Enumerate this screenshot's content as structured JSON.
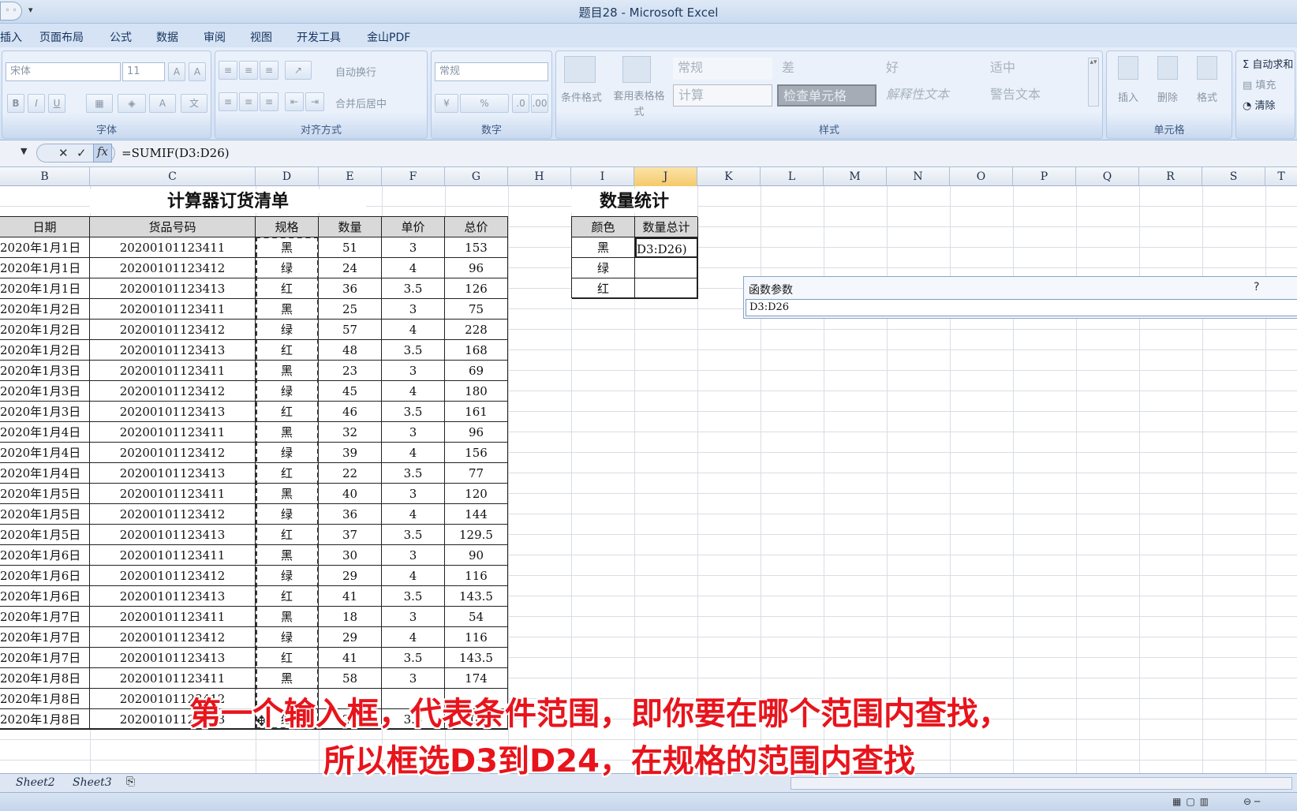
{
  "window": {
    "title": "题目28 - Microsoft Excel"
  },
  "menu": [
    "插入",
    "页面布局",
    "公式",
    "数据",
    "审阅",
    "视图",
    "开发工具",
    "金山PDF"
  ],
  "ribbon": {
    "font_group": {
      "label": "字体",
      "font_name": "宋体",
      "font_size": "11"
    },
    "align_group": {
      "label": "对齐方式",
      "wrap": "自动换行",
      "merge": "合并后居中"
    },
    "number_group": {
      "label": "数字",
      "format": "常规"
    },
    "styles_group": {
      "label": "样式",
      "cond_format": "条件格式",
      "table_format": "套用表格格式",
      "styles": [
        "常规",
        "差",
        "好",
        "适中",
        "计算",
        "检查单元格",
        "解释性文本",
        "警告文本"
      ]
    },
    "cells_group": {
      "label": "单元格",
      "insert": "插入",
      "delete": "删除",
      "format": "格式"
    },
    "edit_group": {
      "autosum": "自动求和",
      "fill": "填充",
      "clear": "清除"
    }
  },
  "formula_bar": {
    "formula": "=SUMIF(D3:D26)"
  },
  "columns": [
    "B",
    "C",
    "D",
    "E",
    "F",
    "G",
    "H",
    "I",
    "J",
    "K",
    "L",
    "M",
    "N",
    "O",
    "P",
    "Q",
    "R",
    "S",
    "T"
  ],
  "table1": {
    "title": "计算器订货清单",
    "headers": [
      "日期",
      "货品号码",
      "规格",
      "数量",
      "单价",
      "总价"
    ],
    "rows": [
      [
        "2020年1月1日",
        "20200101123411",
        "黑",
        "51",
        "3",
        "153"
      ],
      [
        "2020年1月1日",
        "20200101123412",
        "绿",
        "24",
        "4",
        "96"
      ],
      [
        "2020年1月1日",
        "20200101123413",
        "红",
        "36",
        "3.5",
        "126"
      ],
      [
        "2020年1月2日",
        "20200101123411",
        "黑",
        "25",
        "3",
        "75"
      ],
      [
        "2020年1月2日",
        "20200101123412",
        "绿",
        "57",
        "4",
        "228"
      ],
      [
        "2020年1月2日",
        "20200101123413",
        "红",
        "48",
        "3.5",
        "168"
      ],
      [
        "2020年1月3日",
        "20200101123411",
        "黑",
        "23",
        "3",
        "69"
      ],
      [
        "2020年1月3日",
        "20200101123412",
        "绿",
        "45",
        "4",
        "180"
      ],
      [
        "2020年1月3日",
        "20200101123413",
        "红",
        "46",
        "3.5",
        "161"
      ],
      [
        "2020年1月4日",
        "20200101123411",
        "黑",
        "32",
        "3",
        "96"
      ],
      [
        "2020年1月4日",
        "20200101123412",
        "绿",
        "39",
        "4",
        "156"
      ],
      [
        "2020年1月4日",
        "20200101123413",
        "红",
        "22",
        "3.5",
        "77"
      ],
      [
        "2020年1月5日",
        "20200101123411",
        "黑",
        "40",
        "3",
        "120"
      ],
      [
        "2020年1月5日",
        "20200101123412",
        "绿",
        "36",
        "4",
        "144"
      ],
      [
        "2020年1月5日",
        "20200101123413",
        "红",
        "37",
        "3.5",
        "129.5"
      ],
      [
        "2020年1月6日",
        "20200101123411",
        "黑",
        "30",
        "3",
        "90"
      ],
      [
        "2020年1月6日",
        "20200101123412",
        "绿",
        "29",
        "4",
        "116"
      ],
      [
        "2020年1月6日",
        "20200101123413",
        "红",
        "41",
        "3.5",
        "143.5"
      ],
      [
        "2020年1月7日",
        "20200101123411",
        "黑",
        "18",
        "3",
        "54"
      ],
      [
        "2020年1月7日",
        "20200101123412",
        "绿",
        "29",
        "4",
        "116"
      ],
      [
        "2020年1月7日",
        "20200101123413",
        "红",
        "41",
        "3.5",
        "143.5"
      ],
      [
        "2020年1月8日",
        "20200101123411",
        "黑",
        "58",
        "3",
        "174"
      ],
      [
        "2020年1月8日",
        "20200101123412",
        "",
        "",
        "",
        ""
      ],
      [
        "2020年1月8日",
        "20200101123413",
        "红",
        "23",
        "3.5",
        "80.5"
      ]
    ]
  },
  "table2": {
    "title": "数量统计",
    "headers": [
      "颜色",
      "数量总计"
    ],
    "rows": [
      [
        "黑",
        "D3:D26)"
      ],
      [
        "绿",
        ""
      ],
      [
        "红",
        ""
      ]
    ]
  },
  "dialog": {
    "title": "函数参数",
    "help": "?",
    "input_value": "D3:D26"
  },
  "sheet_tabs": [
    "Sheet2",
    "Sheet3"
  ],
  "subtitle": {
    "line1": "第一个输入框，代表条件范围，即你要在哪个范围内查找，",
    "line2": "所以框选D3到D24，在规格的范围内查找"
  }
}
